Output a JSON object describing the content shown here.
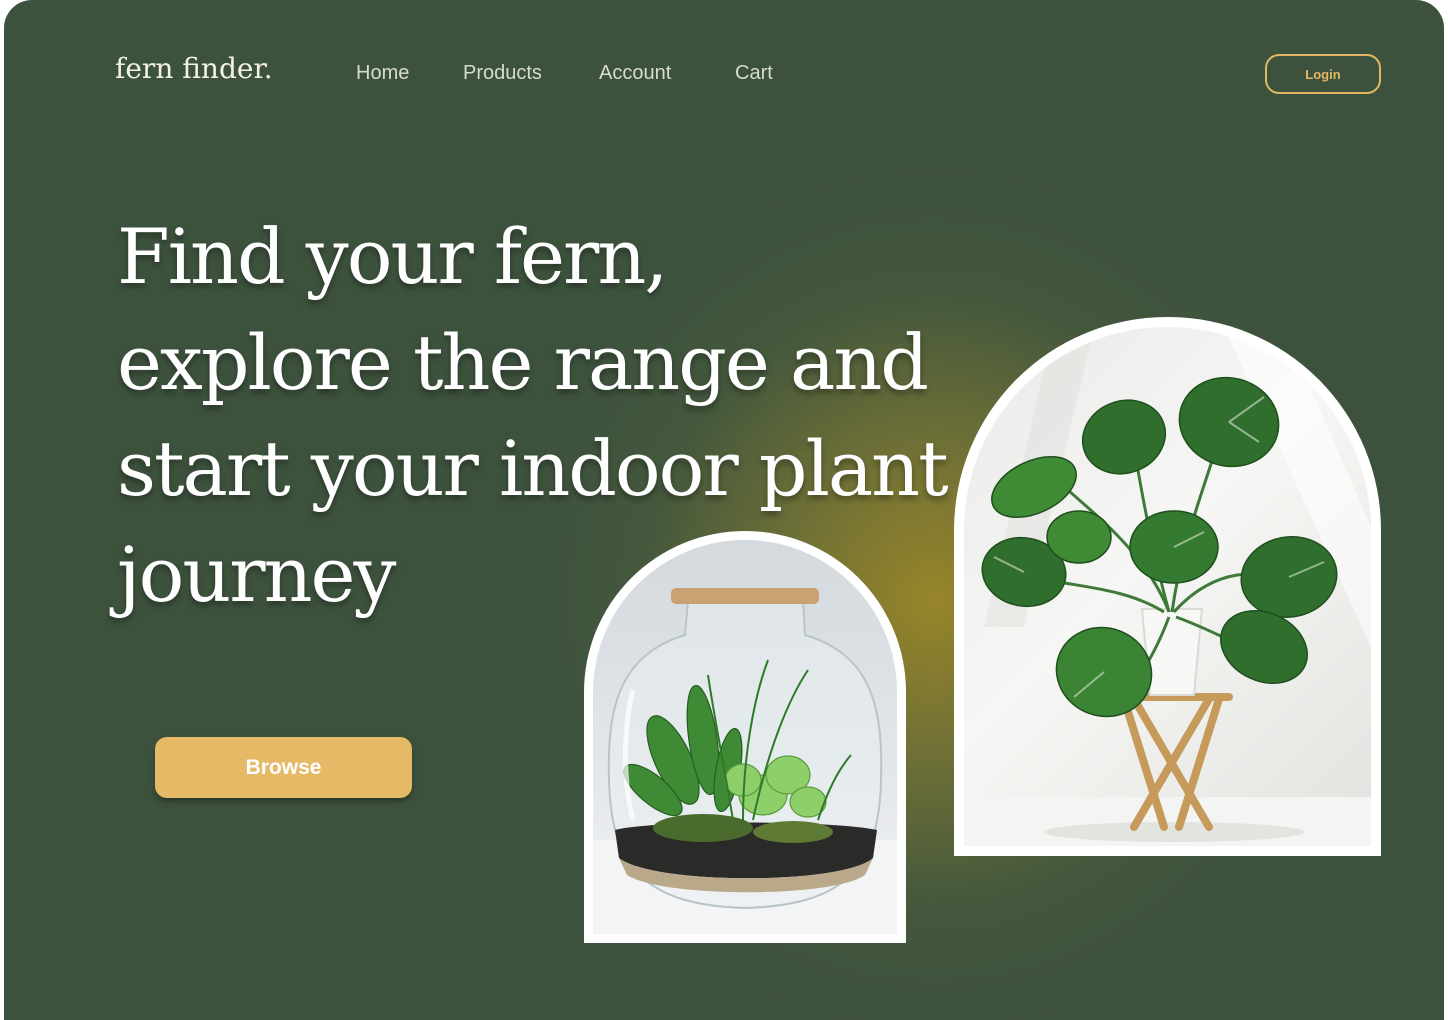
{
  "brand": {
    "logo": "fern finder."
  },
  "nav": {
    "items": [
      {
        "label": "Home"
      },
      {
        "label": "Products"
      },
      {
        "label": "Account"
      },
      {
        "label": "Cart"
      }
    ],
    "login_label": "Login"
  },
  "hero": {
    "headline_lines": [
      "Find your fern,",
      "explore the range and",
      "start your indoor plant",
      "journey"
    ],
    "cta_label": "Browse"
  },
  "colors": {
    "background": "#3d523d",
    "accent": "#e6b966",
    "glow": "#9c8828"
  },
  "images": [
    {
      "name": "terrarium-jar-photo"
    },
    {
      "name": "monstera-plant-photo"
    }
  ]
}
